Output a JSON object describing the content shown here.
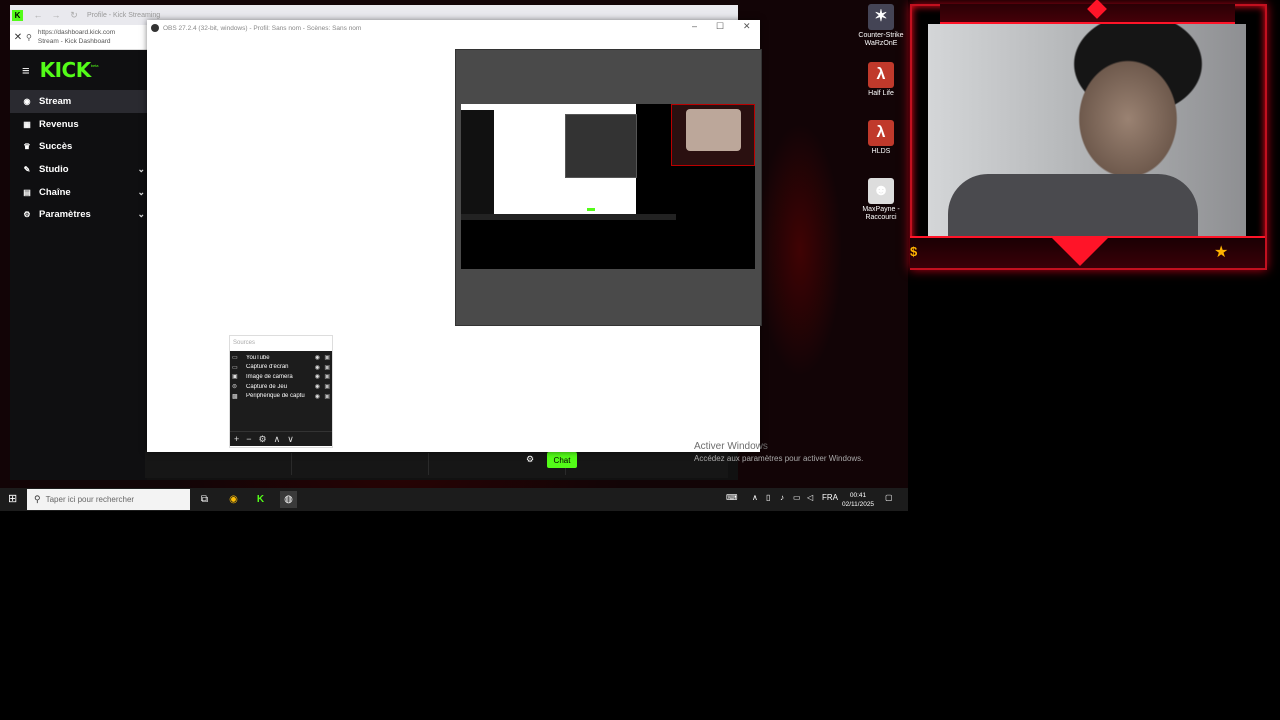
{
  "browser": {
    "tab_title": "Profile - Kick Streaming",
    "url": "https://dashboard.kick.com",
    "page_title": "Stream - Kick Dashboard",
    "close_glyph": "✕"
  },
  "kick": {
    "brand": "KICK",
    "brand_suffix": "beta",
    "nav": [
      {
        "label": "Stream",
        "icon": "broadcast-icon",
        "glyph": "◉",
        "active": true
      },
      {
        "label": "Revenus",
        "icon": "revenue-icon",
        "glyph": "▦"
      },
      {
        "label": "Succès",
        "icon": "achievement-icon",
        "glyph": "♛"
      },
      {
        "label": "Studio",
        "icon": "studio-icon",
        "glyph": "✎",
        "expandable": true
      },
      {
        "label": "Chaîne",
        "icon": "channel-icon",
        "glyph": "▤",
        "expandable": true
      },
      {
        "label": "Paramètres",
        "icon": "settings-icon",
        "glyph": "⚙",
        "expandable": true
      }
    ],
    "chat_button": "Chat"
  },
  "obs": {
    "title": "OBS 27.2.4 (32-bit, windows) - Profil: Sans nom - Scènes: Sans nom",
    "sources_header": "Sources",
    "sources": [
      {
        "name": "YouTube",
        "icon": "monitor-icon",
        "glyph": "▭"
      },
      {
        "name": "Capture d'écran",
        "icon": "monitor-icon",
        "glyph": "▭"
      },
      {
        "name": "Image de camera",
        "icon": "image-icon",
        "glyph": "▣"
      },
      {
        "name": "Capture de Jeu",
        "icon": "gamepad-icon",
        "glyph": "⊜"
      },
      {
        "name": "Périphérique de captu",
        "icon": "camera-icon",
        "glyph": "▩"
      }
    ],
    "toolbar": [
      "+",
      "−",
      "⚙",
      "∧",
      "∨"
    ]
  },
  "windows_activation": {
    "title": "Activer Windows",
    "subtitle": "Accédez aux paramètres pour activer Windows."
  },
  "desktop_icons": [
    {
      "label": "Counter-Strike WaRzOnE",
      "icon": "cs-icon",
      "glyph": "✶",
      "bg": "#445"
    },
    {
      "label": "Half Life",
      "icon": "half-life-icon",
      "glyph": "λ",
      "bg": "#c0392b"
    },
    {
      "label": "HLDS",
      "icon": "hlds-icon",
      "glyph": "λ",
      "bg": "#c0392b"
    },
    {
      "label": "MaxPayne - Raccourci",
      "icon": "maxpayne-icon",
      "glyph": "☻",
      "bg": "#ddd"
    }
  ],
  "taskbar": {
    "search_placeholder": "Taper ici pour rechercher",
    "language": "FRA",
    "time": "00:41",
    "date": "02/11/2025"
  },
  "colors": {
    "kick_green": "#53fc18",
    "overlay_red": "#ff1428"
  }
}
